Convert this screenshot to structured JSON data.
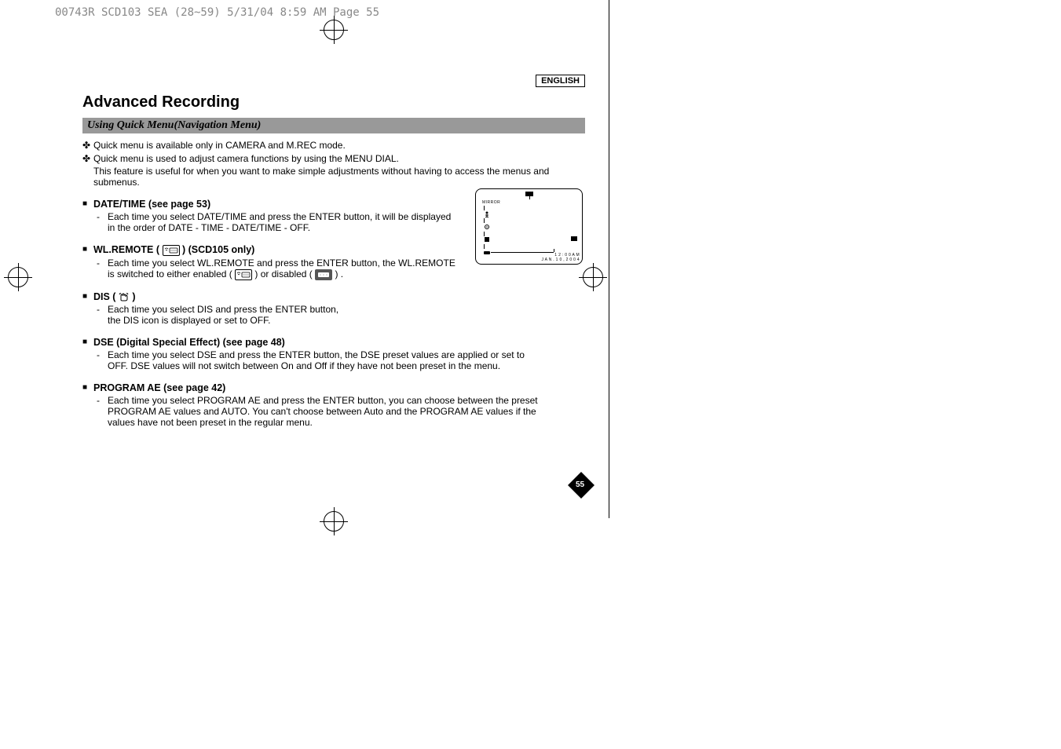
{
  "header_info": "00743R SCD103 SEA (28~59)  5/31/04 8:59 AM  Page 55",
  "language": "ENGLISH",
  "main_title": "Advanced Recording",
  "sub_title": "Using Quick Menu(Navigation Menu)",
  "intro": {
    "line1": "Quick menu is available only in CAMERA and M.REC mode.",
    "line2": "Quick menu is used to adjust camera functions by using the MENU DIAL.",
    "line3": "This feature is useful for when you want to make simple adjustments without having to access the menus and submenus."
  },
  "sections": {
    "datetime": {
      "title": "DATE/TIME (see page 53)",
      "body": "Each time you select DATE/TIME and press the ENTER button, it will be displayed in the order of DATE - TIME - DATE/TIME - OFF."
    },
    "wlremote": {
      "title_prefix": "WL.REMOTE ( ",
      "title_suffix": " ) (SCD105 only)",
      "body_prefix": "Each time you select WL.REMOTE and press the ENTER button, the WL.REMOTE is switched to either enabled ( ",
      "body_mid": " ) or disabled ( ",
      "body_suffix": " ) ."
    },
    "dis": {
      "title_prefix": "DIS ( ",
      "title_suffix": " )",
      "body": "Each time you select DIS and press the ENTER button, the DIS icon is displayed or set to OFF."
    },
    "dse": {
      "title": "DSE (Digital Special Effect) (see page 48)",
      "body": "Each time you select DSE and press the ENTER button, the DSE preset values are applied or set to OFF. DSE values will not switch between On and Off if they have not been preset in the menu."
    },
    "programae": {
      "title": "PROGRAM AE (see page 42)",
      "body": "Each time you select PROGRAM AE and press the ENTER button, you can choose between the preset PROGRAM AE values and AUTO. You can't choose between Auto and the PROGRAM AE values if the values have not been preset in the regular menu."
    }
  },
  "diagram": {
    "mode_label": "MIRROR",
    "time_text": "1 2 : 0 0 A M",
    "date_text": "J A N . 1 0 , 2 0 0 4"
  },
  "page_number": "55"
}
